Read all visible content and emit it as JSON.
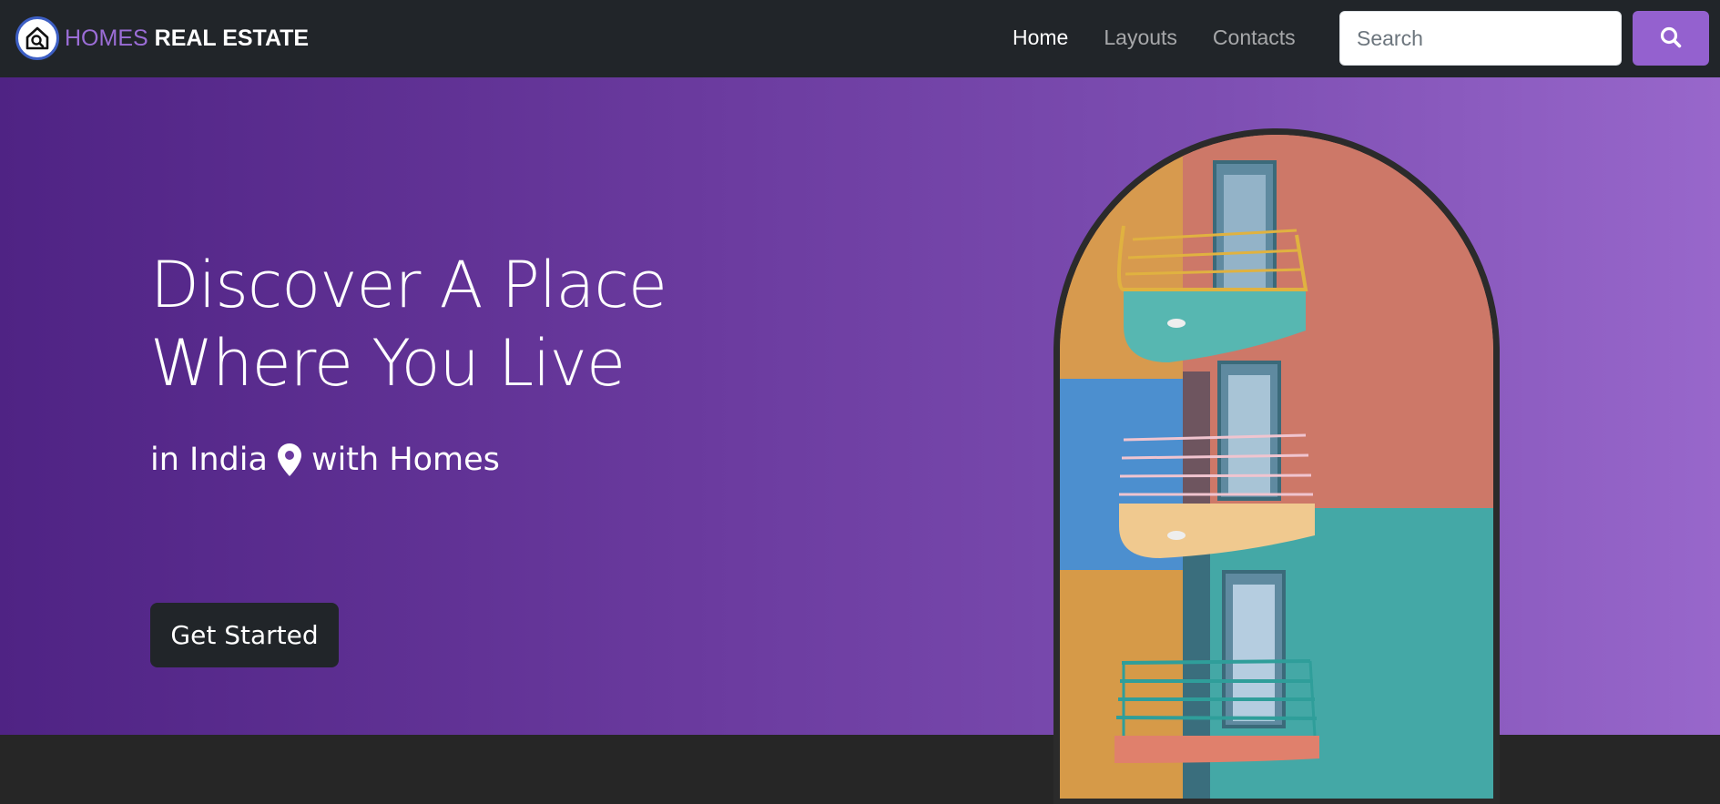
{
  "brand": {
    "homes": "HOMES",
    "real_estate": "REAL ESTATE",
    "logo_icon": "house-search-icon"
  },
  "nav": {
    "items": [
      {
        "label": "Home",
        "active": true
      },
      {
        "label": "Layouts",
        "active": false
      },
      {
        "label": "Contacts",
        "active": false
      }
    ]
  },
  "search": {
    "placeholder": "Search",
    "value": "",
    "button_icon": "search-icon"
  },
  "hero": {
    "title": "Discover A Place\nWhere You Live",
    "sub_prefix": "in India",
    "sub_icon": "map-pin-icon",
    "sub_suffix": "with Homes",
    "cta_label": "Get Started",
    "image_alt": "colorful building with balconies"
  },
  "colors": {
    "accent": "#9461cf",
    "navbar": "#212529",
    "gradient_start": "#4f2384",
    "gradient_end": "#9867cb"
  }
}
